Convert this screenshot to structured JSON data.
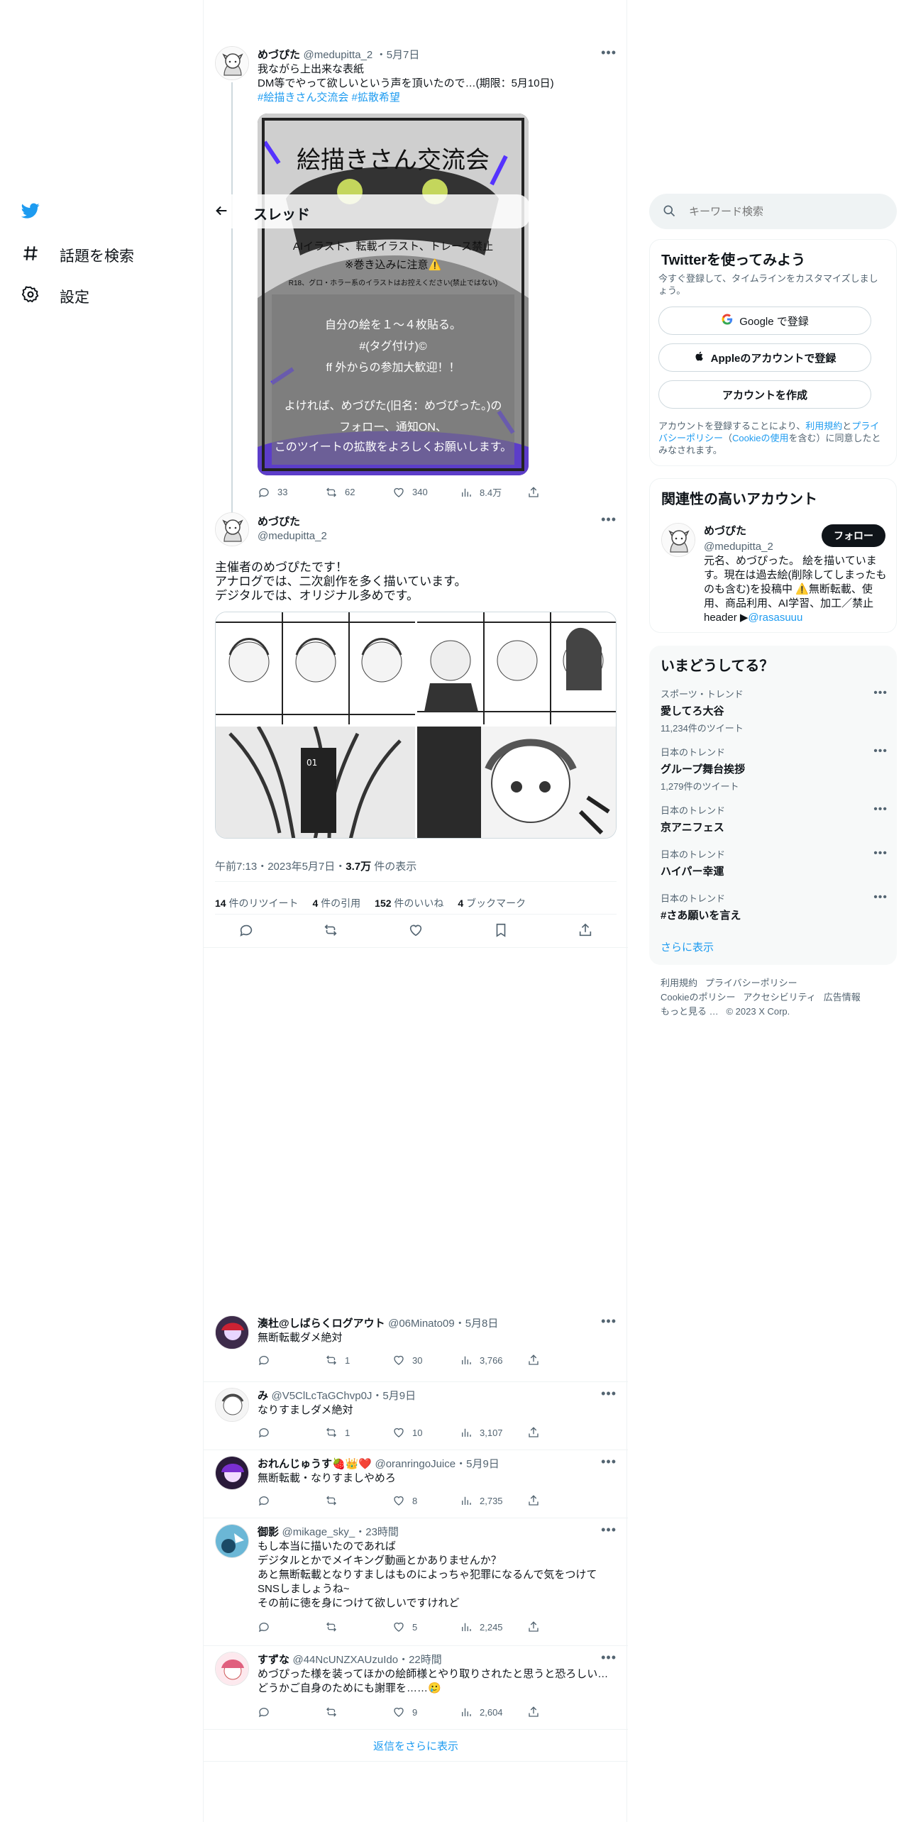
{
  "nav": {
    "explore_label": "話題を検索",
    "settings_label": "設定"
  },
  "thread_header": {
    "title": "スレッド"
  },
  "parent_tweet": {
    "name": "めづぴた",
    "handle": "@medupitta_2",
    "date": "・5月7日",
    "line1": "我ながら上出来な表紙",
    "line2": "DM等でやって欲しいという声を頂いたので…(期限：5月10日)",
    "hashtags": "#絵描きさん交流会 #拡散希望",
    "image_lines": {
      "title": "絵描きさん交流会",
      "l1": "AIイラスト、転載イラスト、トレース禁止",
      "l2": "※巻き込みに注意⚠️",
      "l3": "R18、グロ・ホラー系のイラストはお控えください(禁止ではない)",
      "l4": "自分の絵を１〜４枚貼る。",
      "l5": "#(タグ付け)©",
      "l6": "ff 外からの参加大歓迎！！",
      "l7": "よければ、めづぴた(旧名：めづぴった。)の",
      "l8": "フォロー、通知ON、",
      "l9": "このツイートの拡散をよろしくお願いします。"
    },
    "replies": "33",
    "retweets": "62",
    "likes": "340",
    "views": "8.4万"
  },
  "main_tweet": {
    "name": "めづぴた",
    "handle": "@medupitta_2",
    "text": "主催者のめづぴたです！\nアナログでは、二次創作を多く描いています。\nデジタルでは、オリジナル多めです。",
    "time": "午前7:13・2023年5月7日・",
    "views_count": "3.7万",
    "views_label": " 件の表示",
    "stats": {
      "retweets_n": "14",
      "retweets_l": " 件のリツイート",
      "quotes_n": "4",
      "quotes_l": " 件の引用",
      "likes_n": "152",
      "likes_l": " 件のいいね",
      "bookmarks_n": "4",
      "bookmarks_l": " ブックマーク"
    }
  },
  "replies": [
    {
      "name": "湊杜@しばらくログアウト",
      "handle": "@06Minato09",
      "date": "・5月8日",
      "text": "無断転載ダメ絶対",
      "rt": "1",
      "likes": "30",
      "views": "3,766"
    },
    {
      "name": "み",
      "handle": "@V5ClLcTaGChvp0J",
      "date": "・5月9日",
      "text": "なりすましダメ絶対",
      "rt": "1",
      "likes": "10",
      "views": "3,107"
    },
    {
      "name": "おれんじゅうす🍓👑❤️",
      "handle": "@oranringoJuice",
      "date": "・5月9日",
      "text": "無断転載・なりすましやめろ",
      "rt": "",
      "likes": "8",
      "views": "2,735"
    },
    {
      "name": "御影",
      "handle": "@mikage_sky_",
      "date": "・23時間",
      "text": "もし本当に描いたのであれば\nデジタルとかでメイキング動画とかありませんか？\nあと無断転載となりすましはものによっちゃ犯罪になるんで気をつけて\nSNSしましょうね~\nその前に徳を身につけて欲しいですけれど",
      "rt": "",
      "likes": "5",
      "views": "2,245"
    },
    {
      "name": "すずな",
      "handle": "@44NcUNZXAUzuIdo",
      "date": "・22時間",
      "text": "めづぴった様を装ってほかの絵師様とやり取りされたと思うと恐ろしい…\nどうかご自身のためにも謝罪を……🥲",
      "rt": "",
      "likes": "9",
      "views": "2,604"
    }
  ],
  "show_more_replies": "返信をさらに表示",
  "search": {
    "placeholder": "キーワード検索"
  },
  "signup_card": {
    "title": "Twitterを使ってみよう",
    "subtitle": "今すぐ登録して、タイムラインをカスタマイズしましょう。",
    "google": "Google で登録",
    "apple": "Appleのアカウントで登録",
    "create": "アカウントを作成",
    "legal_1": "アカウントを登録することにより、",
    "legal_terms": "利用規約",
    "legal_and": "と",
    "legal_privacy": "プライバシーポリシー",
    "legal_paren_open": "（",
    "legal_cookie": "Cookieの使用",
    "legal_2": "を含む）に同意したとみなされます。"
  },
  "related_card": {
    "title": "関連性の高いアカウント",
    "name": "めづぴた",
    "handle": "@medupitta_2",
    "follow": "フォロー",
    "bio": "元名、めづぴった。 絵を描いています。現在は過去絵(削除してしまったものも含む)を投稿中 ⚠️無断転載、使用、商品利用、AI学習、加工／禁止",
    "bio_header": "header ▶",
    "bio_link": "@rasasuuu"
  },
  "trends_card": {
    "title": "いまどうしてる？",
    "items": [
      {
        "category": "スポーツ・トレンド",
        "title": "愛してろ大谷",
        "count": "11,234件のツイート"
      },
      {
        "category": "日本のトレンド",
        "title": "グループ舞台挨拶",
        "count": "1,279件のツイート"
      },
      {
        "category": "日本のトレンド",
        "title": "京アニフェス",
        "count": ""
      },
      {
        "category": "日本のトレンド",
        "title": "ハイパー幸運",
        "count": ""
      },
      {
        "category": "日本のトレンド",
        "title": "#さあ願いを言え",
        "count": ""
      }
    ],
    "show_more": "さらに表示"
  },
  "footer": {
    "terms": "利用規約",
    "privacy": "プライバシーポリシー",
    "cookie": "Cookieのポリシー",
    "accessibility": "アクセシビリティ",
    "ads": "広告情報",
    "more": "もっと見る …",
    "copyright": "© 2023 X Corp."
  },
  "colors": {
    "accent": "#1d9bf0",
    "text": "#0f1419",
    "muted": "#536471"
  }
}
